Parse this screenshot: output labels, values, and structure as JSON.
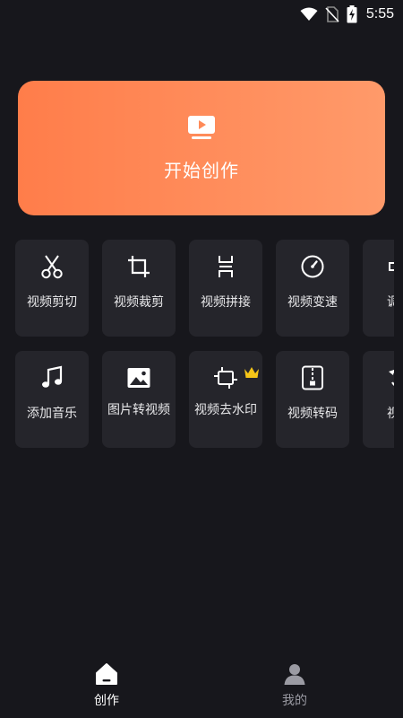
{
  "status_bar": {
    "time": "5:55",
    "icons": [
      "wifi-icon",
      "no-sim-icon",
      "battery-charging-icon"
    ]
  },
  "hero": {
    "label": "开始创作",
    "icon": "tv-play-icon",
    "gradient": [
      "#ff7d4a",
      "#ff9a6a"
    ]
  },
  "tools": [
    {
      "label": "视频剪切",
      "icon": "scissors-icon"
    },
    {
      "label": "视频裁剪",
      "icon": "crop-icon"
    },
    {
      "label": "视频拼接",
      "icon": "merge-icon"
    },
    {
      "label": "视频变速",
      "icon": "speed-gauge-icon"
    },
    {
      "label": "调整",
      "icon": "volume-icon"
    },
    {
      "label": "添加音乐",
      "icon": "music-note-icon"
    },
    {
      "label": "图片转视频",
      "icon": "image-icon"
    },
    {
      "label": "视频去水印",
      "icon": "watermark-remove-icon",
      "badge": "crown-icon"
    },
    {
      "label": "视频转码",
      "icon": "zip-file-icon"
    },
    {
      "label": "视频",
      "icon": "rotate-icon"
    }
  ],
  "tabbar": {
    "tabs": [
      {
        "label": "创作",
        "icon": "home-icon",
        "active": true
      },
      {
        "label": "我的",
        "icon": "user-icon",
        "active": false
      }
    ]
  },
  "colors": {
    "background": "#17171c",
    "card": "#25252b",
    "accent": "#ff7d4a",
    "crown": "#f5c518",
    "tab_active": "#ffffff",
    "tab_inactive": "#9b9ba3"
  }
}
